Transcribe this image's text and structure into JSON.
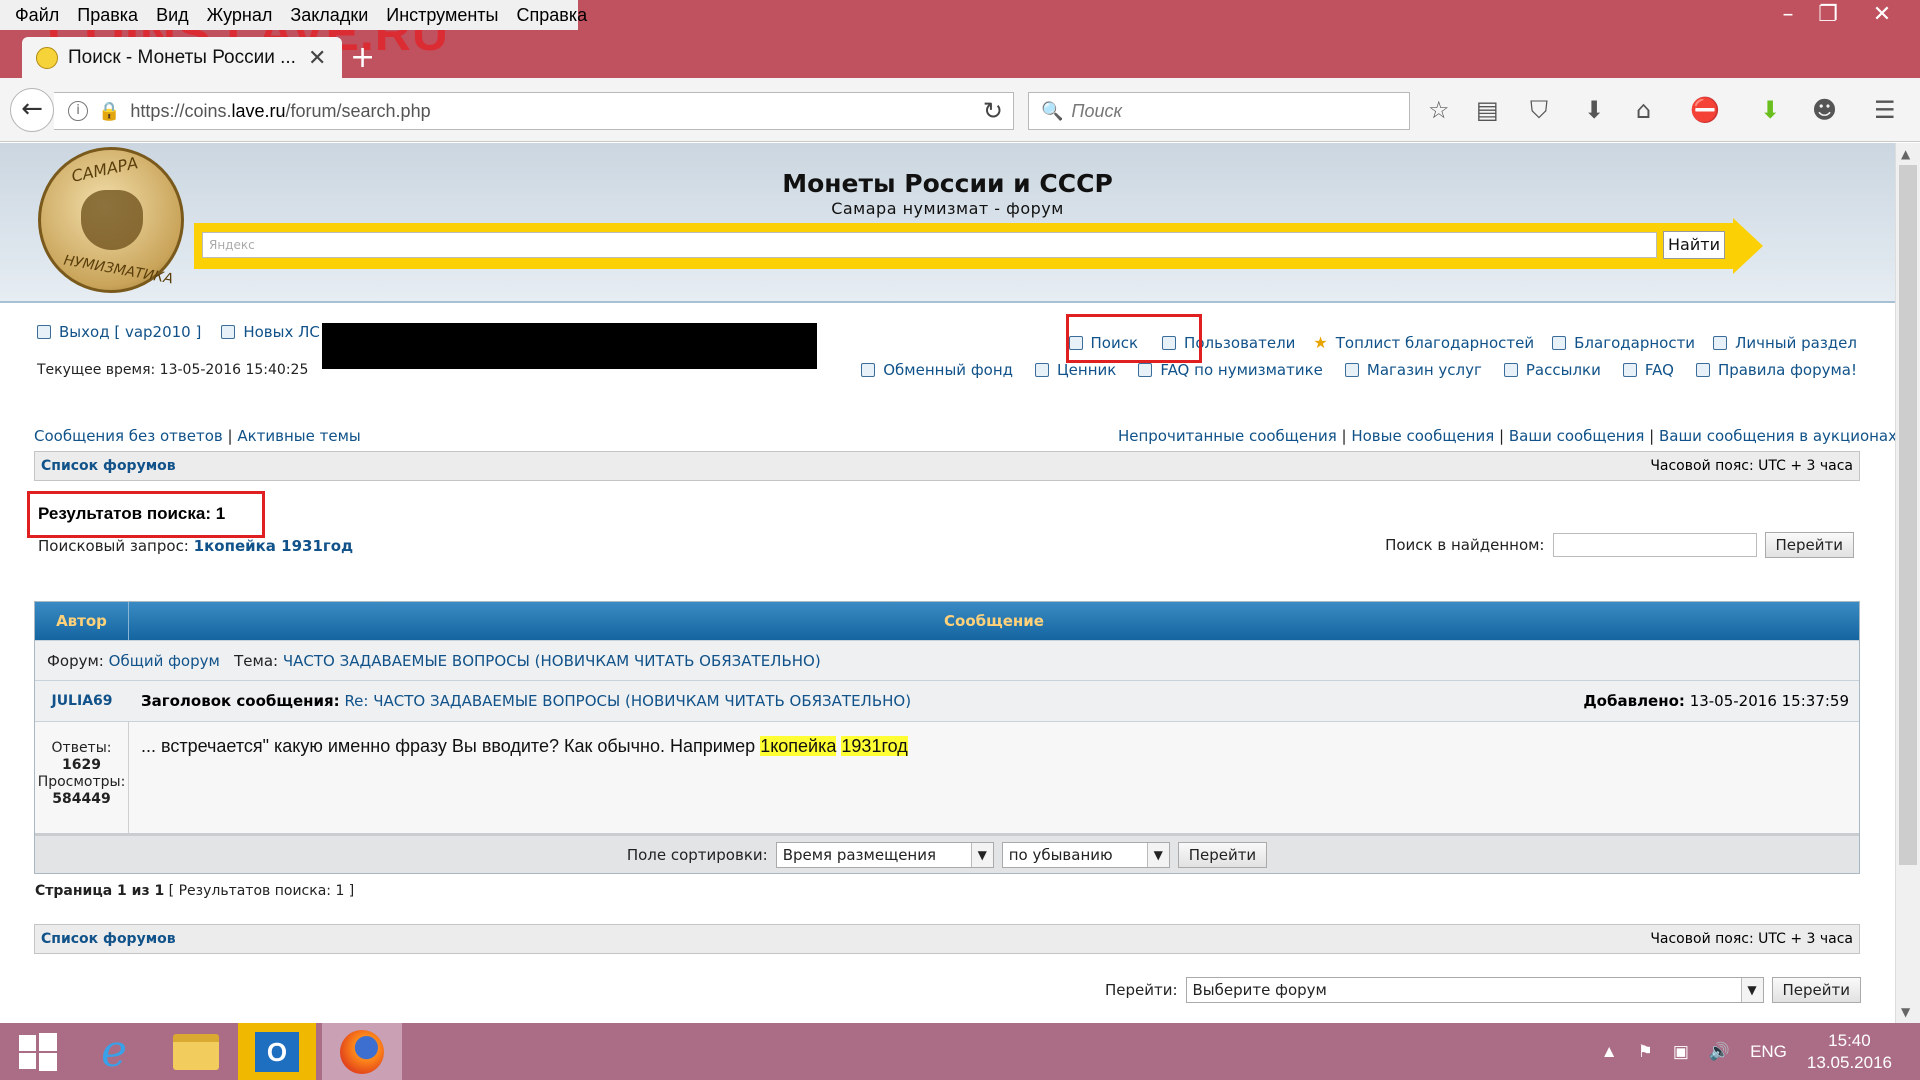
{
  "browser": {
    "menu": [
      "Файл",
      "Правка",
      "Вид",
      "Журнал",
      "Закладки",
      "Инструменты",
      "Справка"
    ],
    "watermark": "COINS.LAVE.RU",
    "tab_title": "Поиск - Монеты России ...",
    "url_prefix": "https://coins.",
    "url_domain": "lave.ru",
    "url_suffix": "/forum/search.php",
    "search_placeholder": "Поиск"
  },
  "header": {
    "title": "Монеты России и СССР",
    "subtitle": "Самара нумизмат - форум",
    "logo_top": "САМАРА",
    "logo_bottom": "НУМИЗМАТИКА",
    "yandex_placeholder": "Яндекс",
    "yandex_button": "Найти"
  },
  "user_nav": {
    "logout": "Выход [ vap2010 ]",
    "new_pm": "Новых ЛС",
    "time": "Текущее время: 13-05-2016 15:40:25"
  },
  "top_links": {
    "row1": [
      "Поиск",
      "Пользователи",
      "Топлист благодарностей",
      "Благодарности",
      "Личный раздел"
    ],
    "row2": [
      "Обменный фонд",
      "Ценник",
      "FAQ по нумизматике",
      "Магазин услуг",
      "Рассылки",
      "FAQ",
      "Правила форума!"
    ]
  },
  "quick": {
    "left": [
      "Сообщения без ответов",
      "Активные темы"
    ],
    "right": [
      "Непрочитанные сообщения",
      "Новые сообщения",
      "Ваши сообщения",
      "Ваши сообщения в аукционах"
    ]
  },
  "breadcrumb": {
    "forum_list": "Список форумов",
    "timezone": "Часовой пояс: UTC + 3 часа"
  },
  "results": {
    "count": "Результатов поиска: 1",
    "query_label": "Поисковый запрос:",
    "query": "1копейка 1931год",
    "search_in_found": "Поиск в найденном:",
    "go": "Перейти"
  },
  "table": {
    "col_author": "Автор",
    "col_message": "Сообщение",
    "forum_label": "Форум:",
    "forum": "Общий форум",
    "topic_label": "Тема:",
    "topic": "ЧАСТО ЗАДАВАЕМЫЕ ВОПРОСЫ (НОВИЧКАМ ЧИТАТЬ ОБЯЗАТЕЛЬНО)",
    "author": "JULIA69",
    "subject_label": "Заголовок сообщения:",
    "subject": "Re: ЧАСТО ЗАДАВАЕМЫЕ ВОПРОСЫ (НОВИЧКАМ ЧИТАТЬ ОБЯЗАТЕЛЬНО)",
    "added_label": "Добавлено:",
    "added": "13-05-2016 15:37:59",
    "replies_label": "Ответы:",
    "replies": "1629",
    "views_label": "Просмотры:",
    "views": "584449",
    "snippet_text": "... встречается\" какую именно фразу Вы вводите? Как обычно. Например",
    "hl1": "1копейка",
    "hl2": "1931год",
    "sort_label": "Поле сортировки:",
    "sort_field": "Время размещения",
    "sort_dir": "по убыванию",
    "go": "Перейти"
  },
  "pagination": {
    "page": "Страница 1 из 1",
    "results": "[ Результатов поиска: 1 ]"
  },
  "jump": {
    "label": "Перейти:",
    "select": "Выберите форум",
    "go": "Перейти"
  },
  "taskbar": {
    "lang": "ENG",
    "time": "15:40",
    "date": "13.05.2016"
  }
}
